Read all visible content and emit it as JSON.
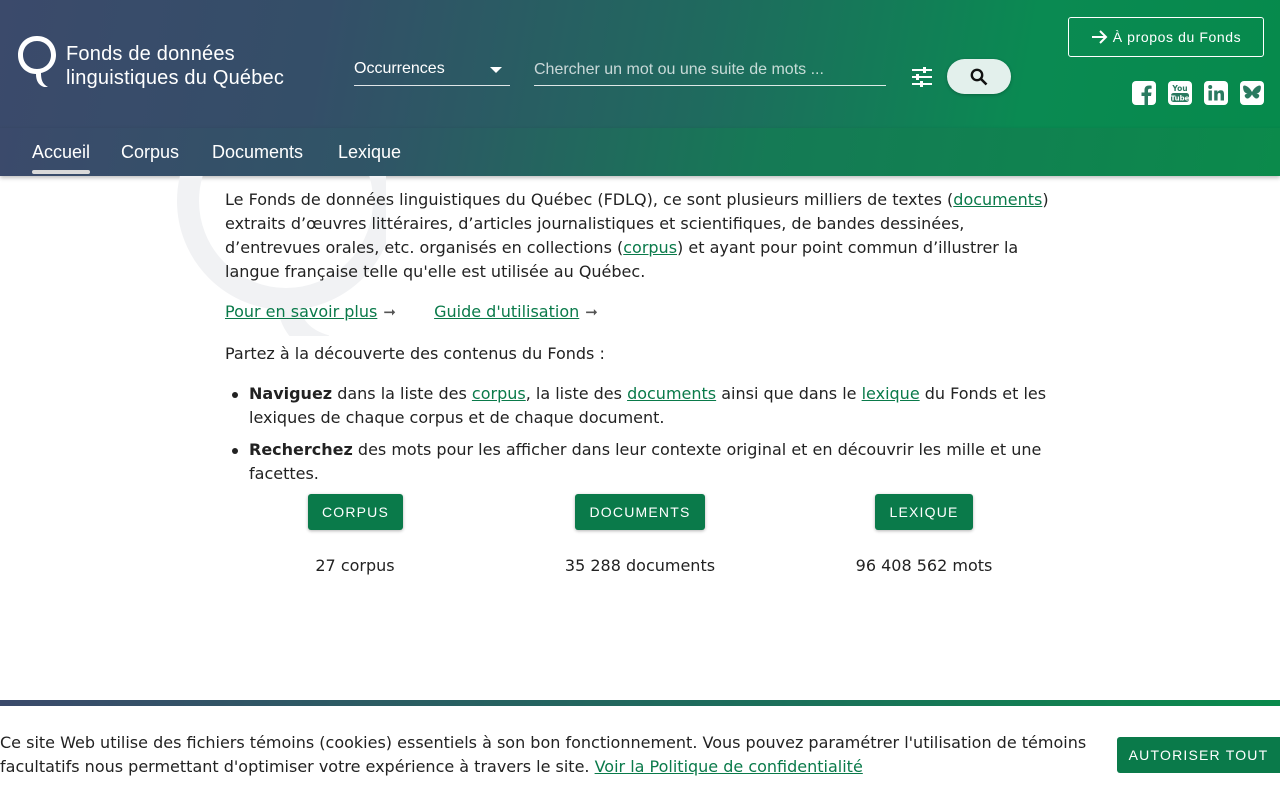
{
  "brand": {
    "line1": "Fonds de données",
    "line2": "linguistiques du Québec"
  },
  "search": {
    "scope": "Occurrences",
    "placeholder": "Chercher un mot ou une suite de mots ..."
  },
  "header": {
    "about_label": "À propos du Fonds",
    "social": [
      "facebook-icon",
      "youtube-icon",
      "linkedin-icon",
      "bluesky-icon"
    ]
  },
  "nav": {
    "items": [
      {
        "label": "Accueil",
        "active": true
      },
      {
        "label": "Corpus"
      },
      {
        "label": "Documents"
      },
      {
        "label": "Lexique"
      }
    ]
  },
  "intro": {
    "p1_a": "Le Fonds de données linguistiques du Québec (FDLQ), ce sont plusieurs milliers de textes (",
    "p1_link1": "documents",
    "p1_b": ") extraits d’œuvres littéraires, d’articles journalistiques et scientifiques, de bandes dessinées, d’entrevues orales, etc. organisés en collections (",
    "p1_link2": "corpus",
    "p1_c": ") et ayant pour point commun d’illustrer la langue française telle qu'elle est utilisée au Québec.",
    "link_more": "Pour en savoir plus",
    "link_guide": "Guide d'utilisation",
    "lead": "Partez à la découverte des contenus du Fonds :",
    "b1_bold": "Naviguez",
    "b1_a": " dans la liste des ",
    "b1_link1": "corpus",
    "b1_b": ", la liste des ",
    "b1_link2": "documents",
    "b1_c": " ainsi que dans le ",
    "b1_link3": "lexique",
    "b1_d": " du Fonds et les lexiques de chaque corpus et de chaque document.",
    "b2_bold": "Recherchez",
    "b2_a": " des mots pour les afficher dans leur contexte original et en découvrir les mille et une facettes."
  },
  "stats": [
    {
      "button": "CORPUS",
      "count": "27 corpus"
    },
    {
      "button": "DOCUMENTS",
      "count": "35 288 documents"
    },
    {
      "button": "LEXIQUE",
      "count": "96 408 562 mots"
    }
  ],
  "cookie": {
    "text": "Ce site Web utilise des fichiers témoins (cookies) essentiels à son bon fonctionnement. Vous pouvez paramétrer l'utilisation de témoins facultatifs nous permettant d'optimiser votre expérience à travers le site. ",
    "link": "Voir la Politique de confidentialité",
    "button": "AUTORISER TOUT"
  },
  "colors": {
    "brand_green": "#0a7a4a",
    "header_blue": "#3b4a6b",
    "header_green": "#068a4c"
  }
}
